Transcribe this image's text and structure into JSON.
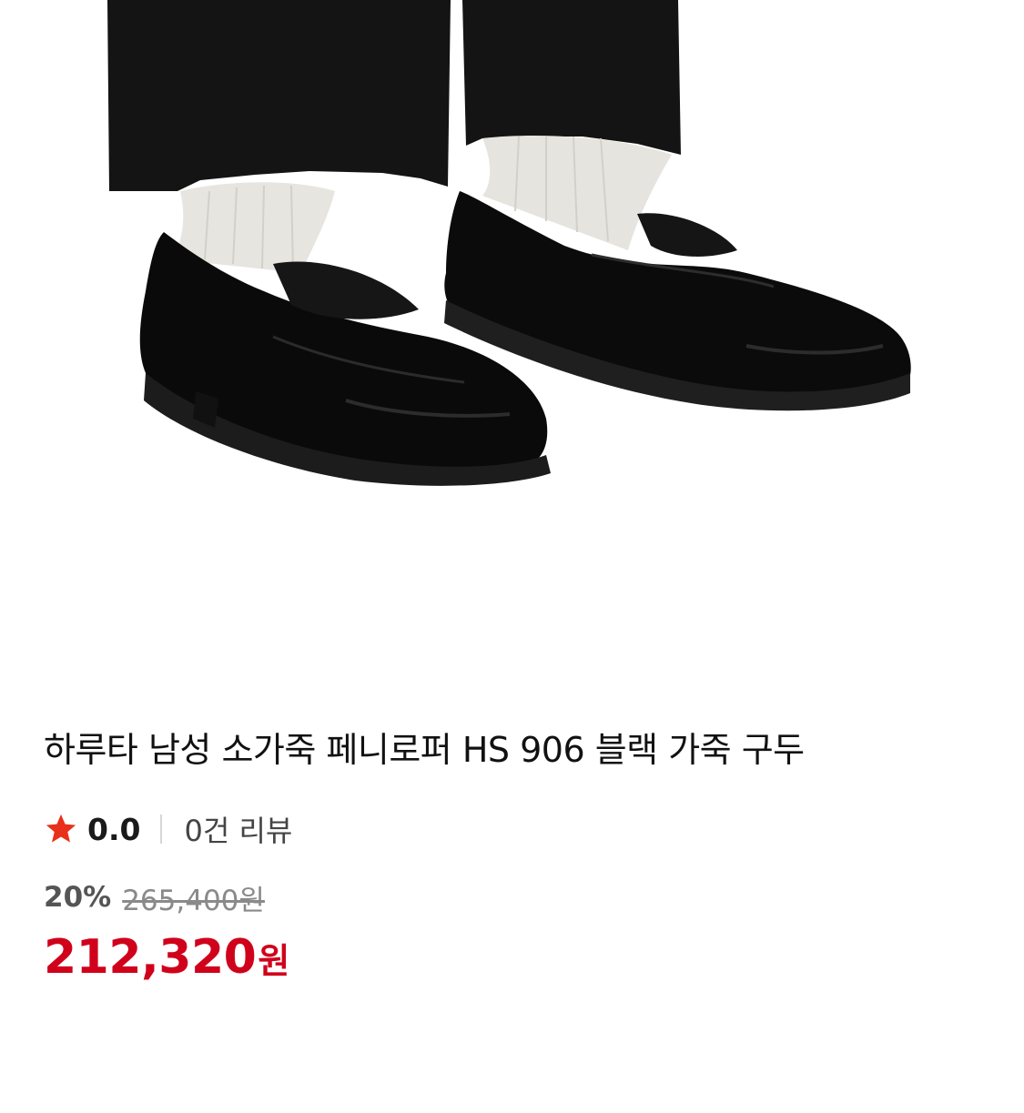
{
  "product": {
    "title": "하루타 남성 소가죽 페니로퍼 HS 906 블랙 가죽 구두",
    "image_alt": "product-photo-black-penny-loafers"
  },
  "rating": {
    "icon": "star-icon",
    "value": "0.0",
    "review_count": "0건 리뷰"
  },
  "price": {
    "discount_rate": "20%",
    "original_price": "265,400원",
    "sale_price": "212,320",
    "unit": "원"
  },
  "colors": {
    "accent": "#d0021b",
    "star": "#e8301c"
  }
}
